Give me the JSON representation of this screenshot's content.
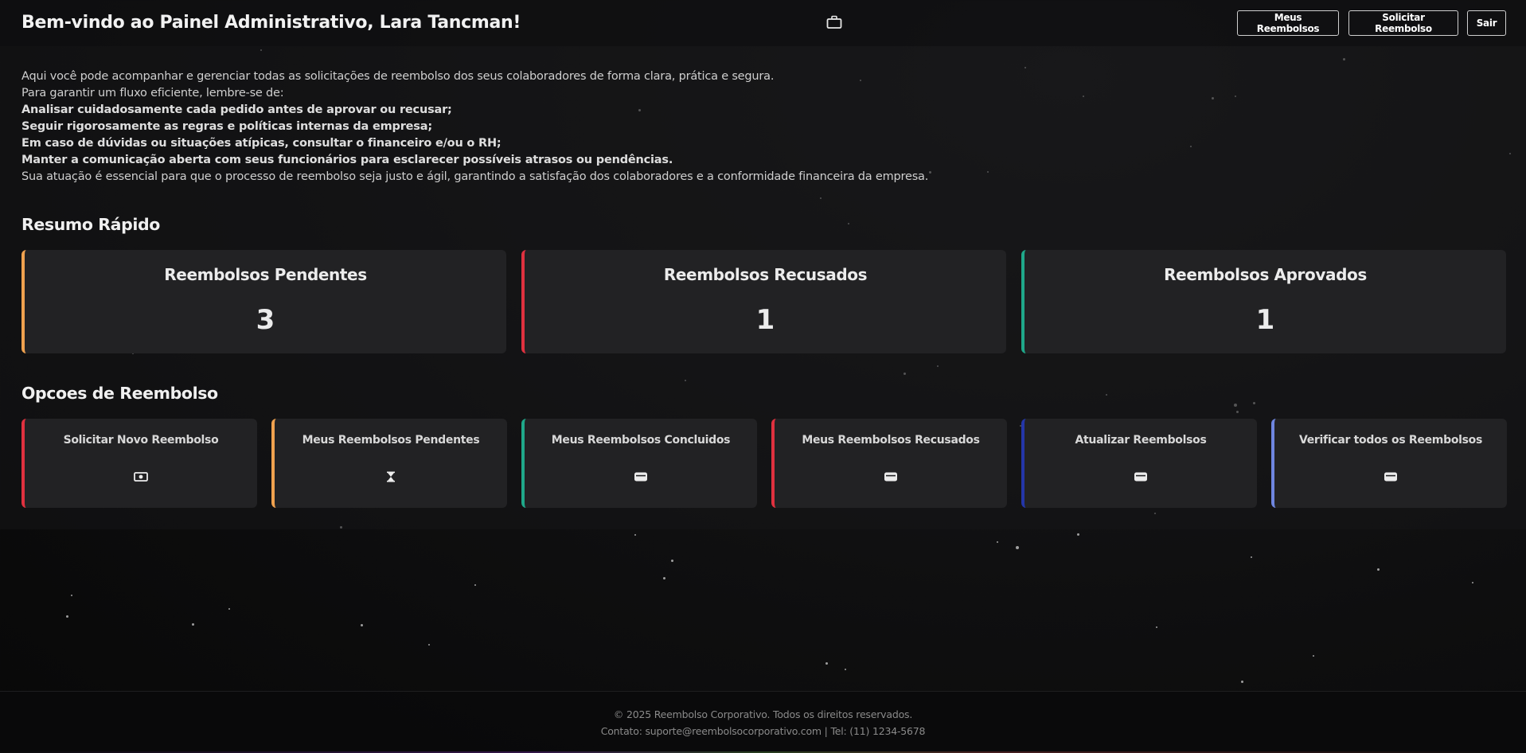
{
  "header": {
    "welcome": "Bem-vindo ao Painel Administrativo, Lara Tancman!",
    "center_icon": "briefcase-icon",
    "buttons": [
      "Meus Reembolsos",
      "Solicitar Reembolso",
      "Sair"
    ]
  },
  "intro": {
    "line1": "Aqui você pode acompanhar e gerenciar todas as solicitações de reembolso dos seus colaboradores de forma clara, prática e segura.",
    "line2": "Para garantir um fluxo eficiente, lembre-se de:",
    "guidelines": [
      "Analisar cuidadosamente cada pedido antes de aprovar ou recusar;",
      "Seguir rigorosamente as regras e políticas internas da empresa;",
      "Em caso de dúvidas ou situações atípicas, consultar o financeiro e/ou o RH;",
      "Manter a comunicação aberta com seus funcionários para esclarecer possíveis atrasos ou pendências."
    ],
    "closing": "Sua atuação é essencial para que o processo de reembolso seja justo e ágil, garantindo a satisfação dos colaboradores e a conformidade financeira da empresa."
  },
  "summary": {
    "heading": "Resumo Rápido",
    "cards": [
      {
        "title": "Reembolsos Pendentes",
        "value": "3",
        "accent": "#f0a24f"
      },
      {
        "title": "Reembolsos Recusados",
        "value": "1",
        "accent": "#e0313f"
      },
      {
        "title": "Reembolsos Aprovados",
        "value": "1",
        "accent": "#1fa88a"
      }
    ]
  },
  "options": {
    "heading": "Opcoes de Reembolso",
    "cards": [
      {
        "label": "Solicitar Novo Reembolso",
        "icon": "money-bill-icon",
        "accent": "#e0313f"
      },
      {
        "label": "Meus Reembolsos Pendentes",
        "icon": "hourglass-icon",
        "accent": "#f0a24f"
      },
      {
        "label": "Meus Reembolsos Concluidos",
        "icon": "wallet-icon",
        "accent": "#1fa88a"
      },
      {
        "label": "Meus Reembolsos Recusados",
        "icon": "wallet-icon",
        "accent": "#e0313f"
      },
      {
        "label": "Atualizar Reembolsos",
        "icon": "wallet-icon",
        "accent": "#2436a8"
      },
      {
        "label": "Verificar todos os Reembolsos",
        "icon": "wallet-icon",
        "accent": "#6f86e0"
      }
    ]
  },
  "footer": {
    "copyright": "© 2025 Reembolso Corporativo. Todos os direitos reservados.",
    "contact": "Contato: suporte@reembolsocorporativo.com | Tel: (11) 1234-5678"
  }
}
